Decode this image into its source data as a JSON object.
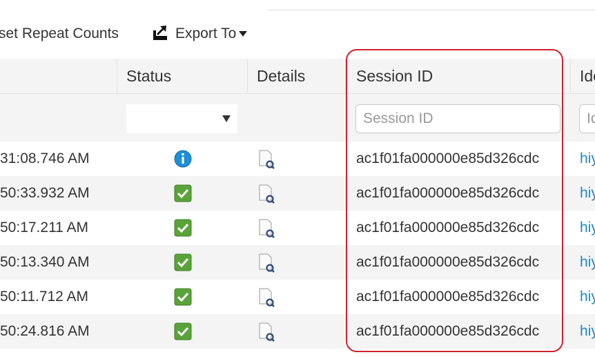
{
  "toolbar": {
    "reset_label": "set Repeat Counts",
    "export_label": "Export To",
    "export_icon": "export-icon",
    "caret_icon": "caret-down-icon"
  },
  "columns": {
    "status": "Status",
    "details": "Details",
    "session_id": "Session ID",
    "identity": "Ide"
  },
  "filters": {
    "session_id_placeholder": "Session ID",
    "identity_placeholder": "Id"
  },
  "rows": [
    {
      "time": "31:08.746 AM",
      "status": "info",
      "session_id": "ac1f01fa000000e85d326cdc",
      "identity": "hiy"
    },
    {
      "time": "50:33.932 AM",
      "status": "success",
      "session_id": "ac1f01fa000000e85d326cdc",
      "identity": "hiy"
    },
    {
      "time": "50:17.211 AM",
      "status": "success",
      "session_id": "ac1f01fa000000e85d326cdc",
      "identity": "hiy"
    },
    {
      "time": "50:13.340 AM",
      "status": "success",
      "session_id": "ac1f01fa000000e85d326cdc",
      "identity": "hiy"
    },
    {
      "time": "50:11.712 AM",
      "status": "success",
      "session_id": "ac1f01fa000000e85d326cdc",
      "identity": "hiy"
    },
    {
      "time": "50:24.816 AM",
      "status": "success",
      "session_id": "ac1f01fa000000e85d326cdc",
      "identity": "hiy"
    }
  ],
  "icons": {
    "info": "info-icon",
    "success": "check-icon",
    "details": "document-magnifier-icon"
  },
  "colors": {
    "highlight": "#d0212c",
    "link": "#1a8ac6",
    "success": "#5aa33a",
    "info": "#1e8fd6"
  }
}
